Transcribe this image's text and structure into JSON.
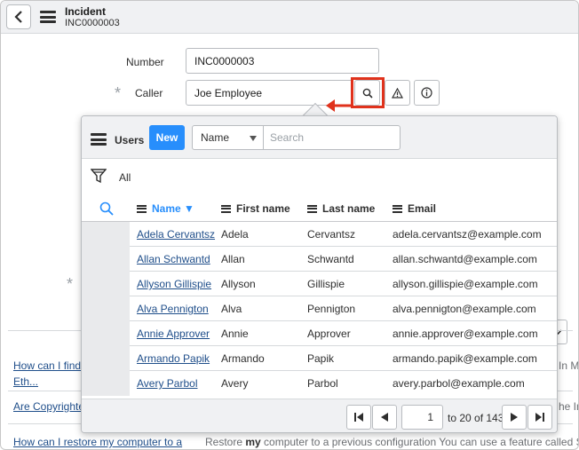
{
  "header": {
    "title": "Incident",
    "subtitle": "INC0000003"
  },
  "form": {
    "number_label": "Number",
    "number_value": "INC0000003",
    "caller_label": "Caller",
    "caller_value": "Joe Employee"
  },
  "background_list": [
    {
      "link": "How can I find th",
      "link2": "Eth...",
      "text": "In Ma"
    },
    {
      "link": "Are Copyrighted",
      "text": "he Inf"
    },
    {
      "link": "How can I restore my computer to a",
      "text_pre": "Restore ",
      "text_bold": "my",
      "text_post": " computer to a previous configuration You can use a feature called System Re"
    }
  ],
  "popup": {
    "title": "Users",
    "new_label": "New",
    "search_field": "Name",
    "search_placeholder": "Search",
    "filter_label": "All",
    "columns": [
      "Name ▼",
      "First name",
      "Last name",
      "Email"
    ],
    "rows": [
      {
        "name": "Adela Cervantsz",
        "first": "Adela",
        "last": "Cervantsz",
        "email": "adela.cervantsz@example.com"
      },
      {
        "name": "Allan Schwantd",
        "first": "Allan",
        "last": "Schwantd",
        "email": "allan.schwantd@example.com"
      },
      {
        "name": "Allyson Gillispie",
        "first": "Allyson",
        "last": "Gillispie",
        "email": "allyson.gillispie@example.com"
      },
      {
        "name": "Alva Pennigton",
        "first": "Alva",
        "last": "Pennigton",
        "email": "alva.pennigton@example.com"
      },
      {
        "name": "Annie Approver",
        "first": "Annie",
        "last": "Approver",
        "email": "annie.approver@example.com"
      },
      {
        "name": "Armando Papik",
        "first": "Armando",
        "last": "Papik",
        "email": "armando.papik@example.com"
      },
      {
        "name": "Avery Parbol",
        "first": "Avery",
        "last": "Parbol",
        "email": "avery.parbol@example.com"
      }
    ],
    "pagination": {
      "current": "1",
      "range_text": "to 20 of 143"
    }
  },
  "colors": {
    "accent": "#278efc",
    "highlight": "#e0321c",
    "link": "#1f4e8a"
  },
  "icons": [
    "back-icon",
    "menu-icon",
    "search-icon",
    "warning-icon",
    "info-icon",
    "filter-icon",
    "first-page-icon",
    "prev-page-icon",
    "next-page-icon",
    "last-page-icon"
  ]
}
